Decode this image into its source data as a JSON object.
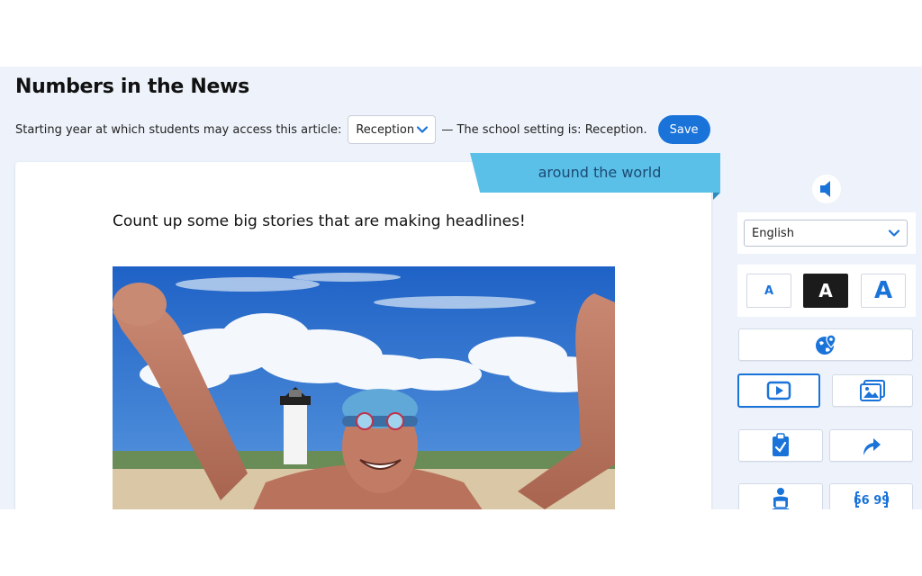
{
  "page": {
    "title": "Numbers in the News"
  },
  "access": {
    "label": "Starting year at which students may access this article:",
    "selected": "Reception",
    "school_setting": "— The school setting is: Reception.",
    "save_label": "Save"
  },
  "article": {
    "category": "around the world",
    "subtitle": "Count up some big stories that are making headlines!"
  },
  "sidebar": {
    "language": "English",
    "font_sizes": [
      "A",
      "A",
      "A"
    ],
    "tools": [
      "globe-location-icon",
      "video-icon",
      "image-gallery-icon",
      "clipboard-icon",
      "share-arrow-icon",
      "reader-icon",
      "quote-icon"
    ]
  },
  "colors": {
    "accent": "#1a73d9",
    "tab": "#5bc0e8",
    "background": "#eef3fb"
  }
}
